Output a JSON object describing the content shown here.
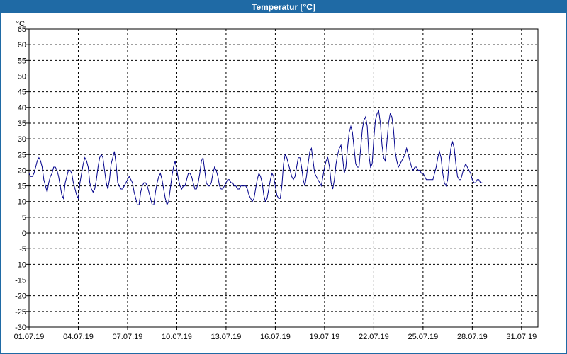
{
  "window": {
    "title": "Temperatur [°C]"
  },
  "colors": {
    "title_bar": "#1f6aa5",
    "series": "#00008b",
    "grid": "#000000"
  },
  "chart_data": {
    "type": "line",
    "title": "Temperatur [°C]",
    "ylabel": "°C",
    "xlabel": "",
    "grid": true,
    "ylim": [
      -30,
      65
    ],
    "yticks": [
      65,
      60,
      55,
      50,
      45,
      40,
      35,
      30,
      25,
      20,
      15,
      10,
      5,
      0,
      -5,
      -10,
      -15,
      -20,
      -25,
      -30
    ],
    "xlim": [
      "01.07.19",
      "31.07.19"
    ],
    "xticks": [
      "01.07.19",
      "04.07.19",
      "07.07.19",
      "10.07.19",
      "13.07.19",
      "16.07.19",
      "19.07.19",
      "22.07.19",
      "25.07.19",
      "28.07.19",
      "31.07.19"
    ],
    "series": [
      {
        "x_days": [
          0.0,
          0.1,
          0.2,
          0.3,
          0.4,
          0.5,
          0.6,
          0.7,
          0.8,
          0.9,
          1.0,
          1.1,
          1.2,
          1.3,
          1.4,
          1.5,
          1.6,
          1.7,
          1.8,
          1.9,
          2.0,
          2.1,
          2.2,
          2.3,
          2.4,
          2.5,
          2.6,
          2.7,
          2.8,
          2.9,
          3.0,
          3.1,
          3.2,
          3.3,
          3.4,
          3.5,
          3.6,
          3.7,
          3.8,
          3.9,
          4.0,
          4.1,
          4.2,
          4.3,
          4.4,
          4.5,
          4.6,
          4.7,
          4.8,
          4.9,
          5.0,
          5.1,
          5.2,
          5.3,
          5.4,
          5.5,
          5.6,
          5.7,
          5.8,
          5.9,
          6.0,
          6.1,
          6.2,
          6.3,
          6.4,
          6.5,
          6.6,
          6.7,
          6.8,
          6.9,
          7.0,
          7.1,
          7.2,
          7.3,
          7.4,
          7.5,
          7.6,
          7.7,
          7.8,
          7.9,
          8.0,
          8.1,
          8.2,
          8.3,
          8.4,
          8.5,
          8.6,
          8.7,
          8.8,
          8.9,
          9.0,
          9.1,
          9.2,
          9.3,
          9.4,
          9.5,
          9.6,
          9.7,
          9.8,
          9.9,
          10.0,
          10.1,
          10.2,
          10.3,
          10.4,
          10.5,
          10.6,
          10.7,
          10.8,
          10.9,
          11.0,
          11.1,
          11.2,
          11.3,
          11.4,
          11.5,
          11.6,
          11.7,
          11.8,
          11.9,
          12.0,
          12.1,
          12.2,
          12.3,
          12.4,
          12.5,
          12.6,
          12.7,
          12.8,
          12.9,
          13.0,
          13.1,
          13.2,
          13.3,
          13.4,
          13.5,
          13.6,
          13.7,
          13.8,
          13.9,
          14.0,
          14.1,
          14.2,
          14.3,
          14.4,
          14.5,
          14.6,
          14.7,
          14.8,
          14.9,
          15.0,
          15.1,
          15.2,
          15.3,
          15.4,
          15.5,
          15.6,
          15.7,
          15.8,
          15.9,
          16.0,
          16.1,
          16.2,
          16.3,
          16.4,
          16.5,
          16.6,
          16.7,
          16.8,
          16.9,
          17.0,
          17.1,
          17.2,
          17.3,
          17.4,
          17.5,
          17.6,
          17.7,
          17.8,
          17.9,
          18.0,
          18.1,
          18.2,
          18.3,
          18.4,
          18.5,
          18.6,
          18.7,
          18.8,
          18.9,
          19.0,
          19.1,
          19.2,
          19.3,
          19.4,
          19.5,
          19.6,
          19.7,
          19.8,
          19.9,
          20.0,
          20.1,
          20.2,
          20.3,
          20.4,
          20.5,
          20.6,
          20.7,
          20.8,
          20.9,
          21.0,
          21.1,
          21.2,
          21.3,
          21.4,
          21.5,
          21.6,
          21.7,
          21.8,
          21.9,
          22.0,
          22.1,
          22.2,
          22.3,
          22.4,
          22.5,
          22.6,
          22.7,
          22.8,
          22.9,
          23.0,
          23.1,
          23.2,
          23.3,
          23.4,
          23.5,
          23.6,
          23.7,
          23.8,
          23.9,
          24.0,
          24.1,
          24.2,
          24.3,
          24.4,
          24.5,
          24.6,
          24.7,
          24.8,
          24.9,
          25.0,
          25.1,
          25.2,
          25.3,
          25.4,
          25.5,
          25.6,
          25.7,
          25.8,
          25.9,
          26.0,
          26.1,
          26.2,
          26.3,
          26.4,
          26.5,
          26.6,
          26.7,
          26.8,
          26.9,
          27.0,
          27.1,
          27.2,
          27.3,
          27.4,
          27.5,
          27.6,
          27.7,
          27.8,
          27.9,
          28.0,
          28.1,
          28.2,
          28.3,
          28.4,
          28.5,
          28.6,
          28.7,
          28.8,
          28.9,
          29.0,
          29.1,
          29.2,
          29.3,
          29.4,
          29.5,
          29.6,
          29.7,
          29.8,
          29.9,
          30.0,
          30.1,
          30.2,
          30.3,
          30.4,
          30.5,
          30.6,
          30.7,
          30.8,
          30.9,
          31.0
        ],
        "values": [
          19,
          18,
          18,
          19,
          21,
          23,
          24,
          23,
          21,
          17,
          15,
          13,
          16,
          18,
          19,
          21,
          21,
          20,
          18,
          15,
          12,
          11,
          16,
          18,
          20,
          20,
          19,
          16,
          14,
          12,
          11,
          16,
          19,
          22,
          24,
          23,
          21,
          16,
          14,
          13,
          14,
          17,
          21,
          24,
          25,
          24,
          20,
          16,
          14,
          17,
          22,
          24,
          26,
          22,
          16,
          15,
          14,
          14,
          15,
          16,
          17,
          18,
          17,
          16,
          13,
          11,
          9,
          9,
          13,
          15,
          16,
          16,
          15,
          13,
          11,
          9,
          9,
          13,
          16,
          18,
          19,
          17,
          14,
          11,
          9,
          10,
          14,
          18,
          21,
          23,
          20,
          17,
          15,
          14,
          15,
          15,
          17,
          19,
          19,
          18,
          16,
          14,
          14,
          16,
          19,
          23,
          24,
          20,
          16,
          15,
          15,
          16,
          19,
          21,
          20,
          18,
          15,
          14,
          14,
          15,
          16,
          17,
          17,
          16,
          16,
          15,
          15,
          14,
          14,
          15,
          15,
          15,
          15,
          14,
          12,
          11,
          10,
          11,
          14,
          17,
          19,
          18,
          16,
          12,
          10,
          11,
          14,
          17,
          19,
          18,
          15,
          12,
          11,
          11,
          15,
          22,
          25,
          24,
          22,
          20,
          18,
          17,
          18,
          21,
          24,
          24,
          21,
          17,
          15,
          18,
          22,
          26,
          27,
          23,
          19,
          18,
          17,
          16,
          15,
          18,
          21,
          23,
          24,
          21,
          16,
          14,
          17,
          22,
          25,
          27,
          28,
          24,
          19,
          21,
          27,
          32,
          34,
          32,
          27,
          22,
          21,
          21,
          27,
          33,
          36,
          37,
          34,
          25,
          21,
          22,
          30,
          36,
          38,
          39,
          35,
          28,
          24,
          23,
          29,
          35,
          38,
          37,
          33,
          26,
          23,
          21,
          22,
          23,
          24,
          25,
          27,
          25,
          23,
          21,
          20,
          21,
          21,
          20,
          20,
          19,
          19,
          18,
          17,
          17,
          17,
          17,
          17,
          19,
          21,
          24,
          26,
          24,
          19,
          16,
          15,
          17,
          23,
          27,
          29,
          27,
          22,
          18,
          17,
          17,
          19,
          21,
          22,
          21,
          20,
          19,
          17,
          16,
          16,
          17,
          17,
          16,
          16
        ]
      }
    ]
  }
}
